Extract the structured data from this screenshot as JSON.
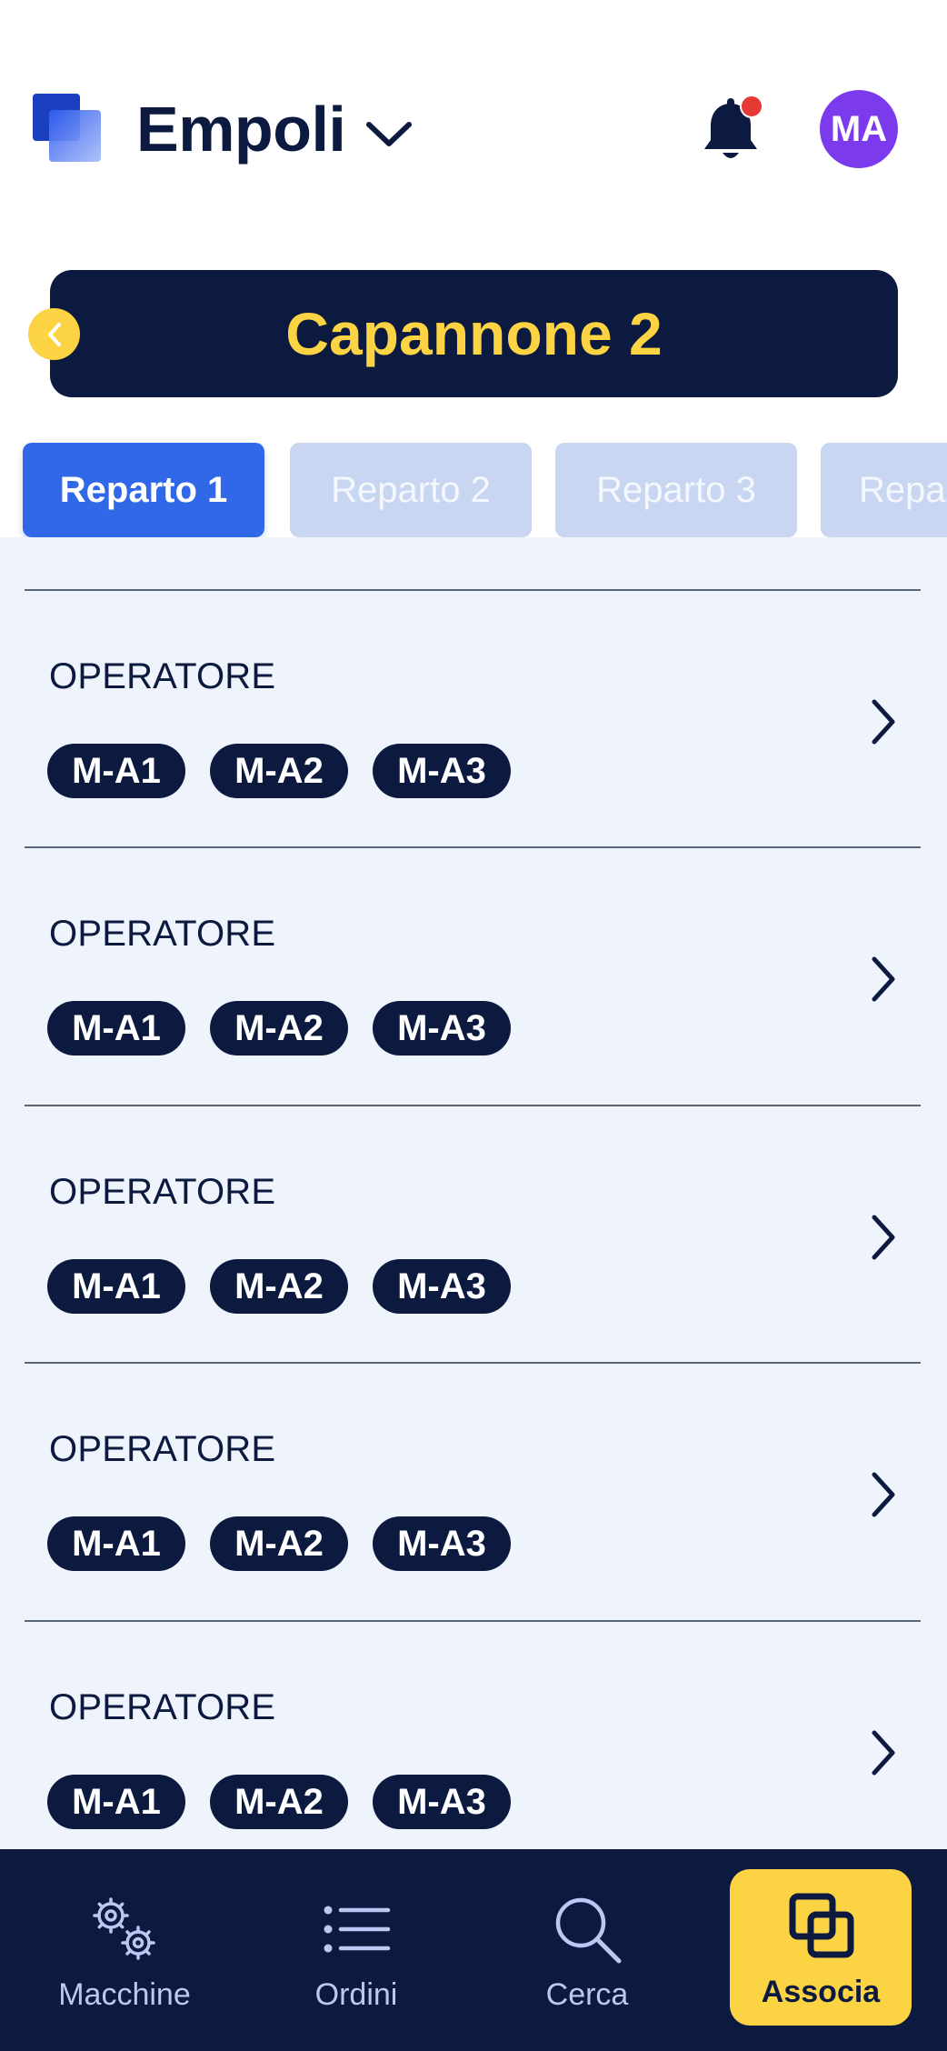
{
  "header": {
    "location": "Empoli",
    "avatar_initials": "MA",
    "notification_dot_color": "#e53935"
  },
  "banner": {
    "title": "Capannone 2"
  },
  "tabs": [
    {
      "label": "Reparto 1",
      "active": true
    },
    {
      "label": "Reparto 2",
      "active": false
    },
    {
      "label": "Reparto 3",
      "active": false
    },
    {
      "label": "Repa",
      "active": false
    }
  ],
  "rows": [
    {
      "label": "OPERATORE",
      "chips": [
        "M-A1",
        "M-A2",
        "M-A3"
      ]
    },
    {
      "label": "OPERATORE",
      "chips": [
        "M-A1",
        "M-A2",
        "M-A3"
      ]
    },
    {
      "label": "OPERATORE",
      "chips": [
        "M-A1",
        "M-A2",
        "M-A3"
      ]
    },
    {
      "label": "OPERATORE",
      "chips": [
        "M-A1",
        "M-A2",
        "M-A3"
      ]
    },
    {
      "label": "OPERATORE",
      "chips": [
        "M-A1",
        "M-A2",
        "M-A3"
      ]
    }
  ],
  "nav": [
    {
      "label": "Macchine",
      "icon": "gears-icon",
      "active": false
    },
    {
      "label": "Ordini",
      "icon": "list-icon",
      "active": false
    },
    {
      "label": "Cerca",
      "icon": "search-icon",
      "active": false
    },
    {
      "label": "Associa",
      "icon": "associate-icon",
      "active": true
    }
  ],
  "colors": {
    "navy": "#0c1a40",
    "accent_yellow": "#fcd443",
    "primary_blue": "#3068e8",
    "avatar_purple": "#7c3aed"
  }
}
